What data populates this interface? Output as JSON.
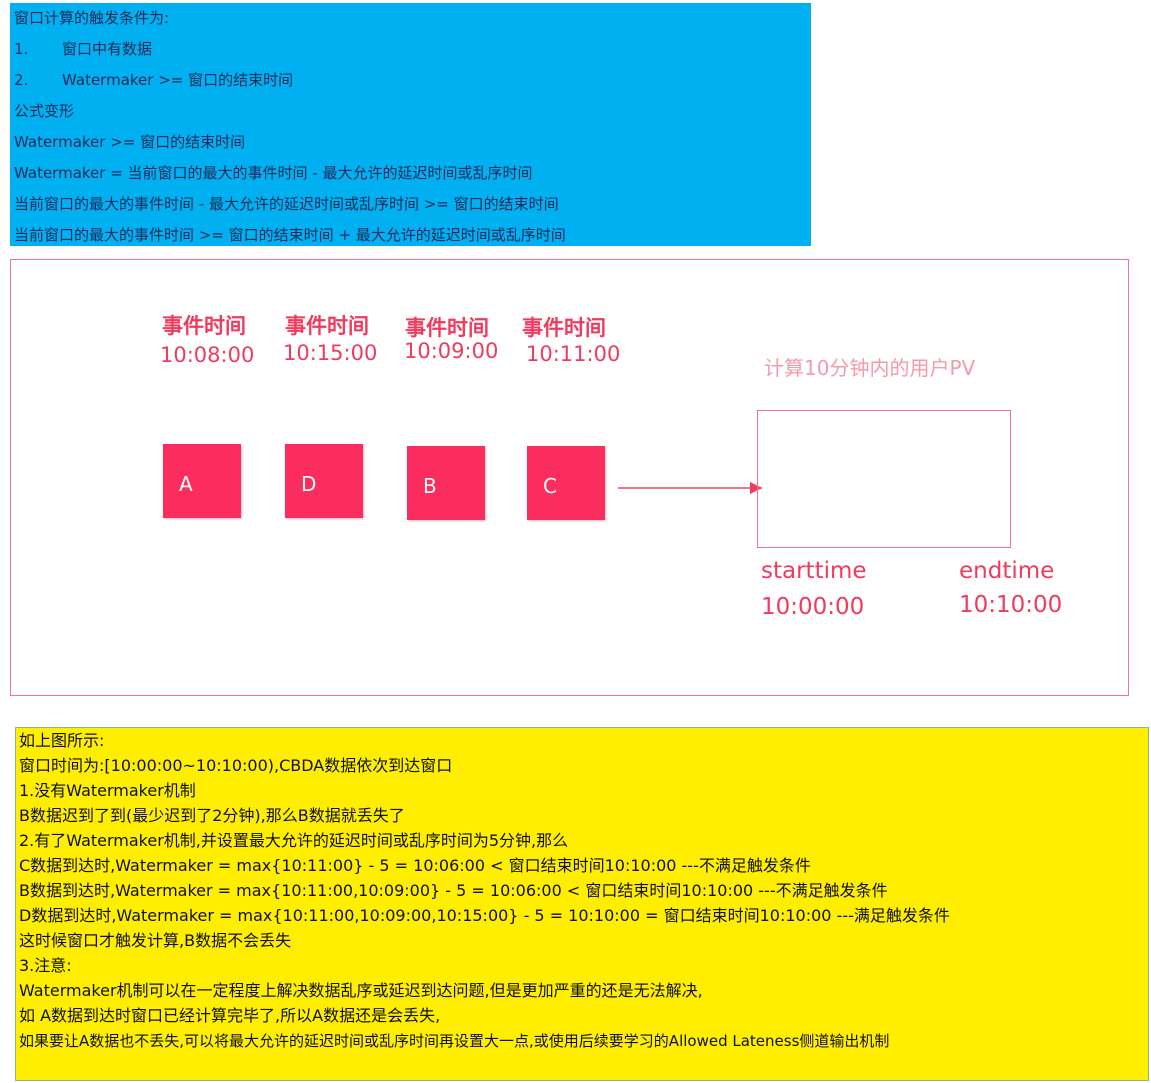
{
  "top_note": {
    "line1": "窗口计算的触发条件为:",
    "item1_num": "1.",
    "item1_text": "窗口中有数据",
    "item2_num": "2.",
    "item2_text": "Watermaker >= 窗口的结束时间",
    "line4": "公式变形",
    "line5": "Watermaker >= 窗口的结束时间",
    "line6": "Watermaker = 当前窗口的最大的事件时间  -  最大允许的延迟时间或乱序时间",
    "line7": "当前窗口的最大的事件时间  -  最大允许的延迟时间或乱序时间  >= 窗口的结束时间",
    "line8": "当前窗口的最大的事件时间  >= 窗口的结束时间 +  最大允许的延迟时间或乱序时间",
    "bg_color": "#00b0f0"
  },
  "diagram": {
    "events": [
      {
        "title": "事件时间",
        "time": "10:08:00",
        "letter": "A"
      },
      {
        "title": "事件时间",
        "time": "10:15:00",
        "letter": "D"
      },
      {
        "title": "事件时间",
        "time": "10:09:00",
        "letter": "B"
      },
      {
        "title": "事件时间",
        "time": "10:11:00",
        "letter": "C"
      }
    ],
    "window_caption": "计算10分钟内的用户PV",
    "start_label": "starttime",
    "start_time": "10:00:00",
    "end_label": "endtime",
    "end_time": "10:10:00",
    "accent_color": "#fb2d5e"
  },
  "bottom_note": {
    "line1": "如上图所示:",
    "line2": "窗口时间为:[10:00:00~10:10:00),CBDA数据依次到达窗口",
    "line3": "1.没有Watermaker机制",
    "line4": " B数据迟到了到(最少迟到了2分钟),那么B数据就丢失了",
    "line5": "2.有了Watermaker机制,并设置最大允许的延迟时间或乱序时间为5分钟,那么",
    "line6": " C数据到达时,Watermaker = max{10:11:00} - 5 = 10:06:00 < 窗口结束时间10:10:00 ---不满足触发条件",
    "line7": " B数据到达时,Watermaker = max{10:11:00,10:09:00} - 5 = 10:06:00 < 窗口结束时间10:10:00 ---不满足触发条件",
    "line8": " D数据到达时,Watermaker = max{10:11:00,10:09:00,10:15:00} - 5 = 10:10:00 = 窗口结束时间10:10:00 ---满足触发条件",
    "line9": " 这时候窗口才触发计算,B数据不会丢失",
    "line10": "3.注意:",
    "line11": " Watermaker机制可以在一定程度上解决数据乱序或延迟到达问题,但是更加严重的还是无法解决,",
    "line12": " 如 A数据到达时窗口已经计算完毕了,所以A数据还是会丢失,",
    "line13": " 如果要让A数据也不丢失,可以将最大允许的延迟时间或乱序时间再设置大一点,或使用后续要学习的Allowed Lateness侧道输出机制",
    "bg_color": "#ffee00"
  }
}
